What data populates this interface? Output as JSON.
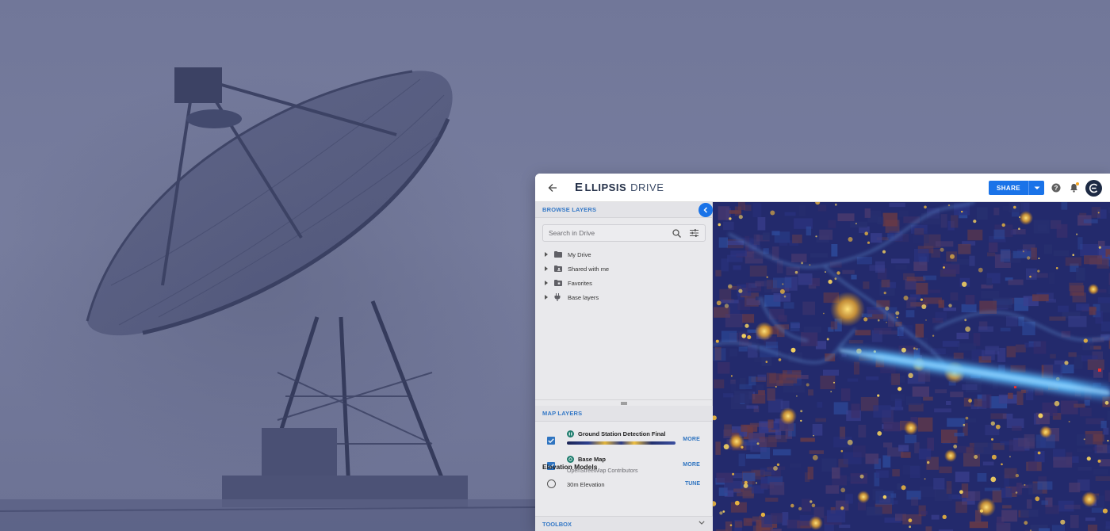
{
  "header": {
    "logo_mark": "E",
    "logo_name": "LLIPSIS",
    "logo_suffix": "DRIVE",
    "share_label": "SHARE"
  },
  "browse": {
    "section_label": "BROWSE LAYERS",
    "search_placeholder": "Search in Drive",
    "items": [
      {
        "label": "My Drive",
        "icon": "folder-icon"
      },
      {
        "label": "Shared with me",
        "icon": "shared-folder-icon"
      },
      {
        "label": "Favorites",
        "icon": "favorite-folder-icon"
      },
      {
        "label": "Base layers",
        "icon": "plug-icon"
      }
    ]
  },
  "map_layers": {
    "section_label": "MAP LAYERS",
    "layers": [
      {
        "name": "Ground Station Detection Final",
        "subtitle": "",
        "checked": true,
        "action": "MORE"
      },
      {
        "name": "Base Map",
        "subtitle": "OpenStreetMap Contributors",
        "checked": true,
        "action": "MORE"
      }
    ]
  },
  "elevation": {
    "title": "Elevation Models",
    "models": [
      {
        "name": "30m Elevation",
        "selected": false,
        "action": "TUNE"
      }
    ]
  },
  "toolbox": {
    "label": "TOOLBOX"
  },
  "colors": {
    "accent": "#1a73e8",
    "link": "#2f74c0",
    "panel_bg": "#e9e9ec",
    "fog": "#767c9c",
    "map_base": "#1f2666",
    "map_highlight": "#f0c040",
    "beam": "#3aa0ff"
  }
}
